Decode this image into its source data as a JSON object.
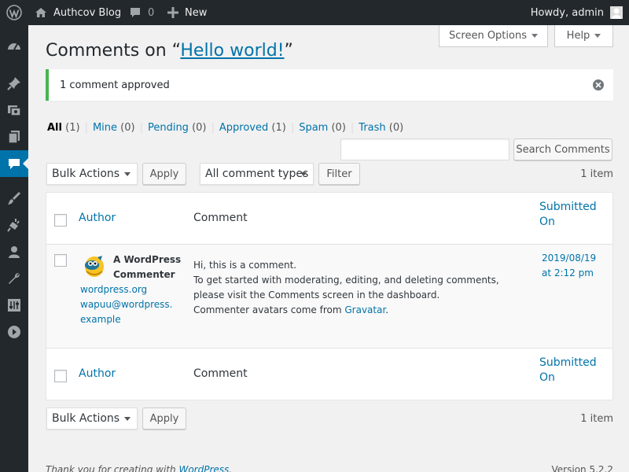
{
  "adminbar": {
    "site_name": "Authcov Blog",
    "comments_count": "0",
    "new_label": "New",
    "howdy": "Howdy, admin"
  },
  "header": {
    "screen_options": "Screen Options",
    "help": "Help",
    "title_prefix": "Comments on “",
    "title_link": "Hello world!",
    "title_suffix": "”"
  },
  "notice": {
    "message": "1 comment approved"
  },
  "filters": [
    {
      "label": "All",
      "count": "(1)"
    },
    {
      "label": "Mine",
      "count": "(0)"
    },
    {
      "label": "Pending",
      "count": "(0)"
    },
    {
      "label": "Approved",
      "count": "(1)"
    },
    {
      "label": "Spam",
      "count": "(0)"
    },
    {
      "label": "Trash",
      "count": "(0)"
    }
  ],
  "search": {
    "value": "",
    "button": "Search Comments"
  },
  "toolbar": {
    "bulk_actions": "Bulk Actions",
    "apply": "Apply",
    "comment_types": "All comment types",
    "filter": "Filter",
    "items": "1 item"
  },
  "table": {
    "col_author": "Author",
    "col_comment": "Comment",
    "col_submitted_1": "Submitted",
    "col_submitted_2": "On",
    "row": {
      "author_name_1": "A WordPress",
      "author_name_2": "Commenter",
      "author_url": "wordpress.org",
      "author_email_1": "wapuu@wordpress.",
      "author_email_2": "example",
      "comment_line1": "Hi, this is a comment.",
      "comment_line2": "To get started with moderating, editing, and deleting comments, please visit the Comments screen in the dashboard.",
      "comment_line3_prefix": "Commenter avatars come from ",
      "comment_line3_link": "Gravatar",
      "comment_line3_suffix": ".",
      "date_1": "2019/08/19",
      "date_2": "at 2:12 pm"
    }
  },
  "footer": {
    "thanks_prefix": "Thank you for creating with ",
    "thanks_link": "WordPress",
    "thanks_suffix": ".",
    "version": "Version 5.2.2"
  },
  "colors": {
    "adminbar": "#23282d",
    "accent": "#0073aa",
    "success": "#46b450"
  }
}
